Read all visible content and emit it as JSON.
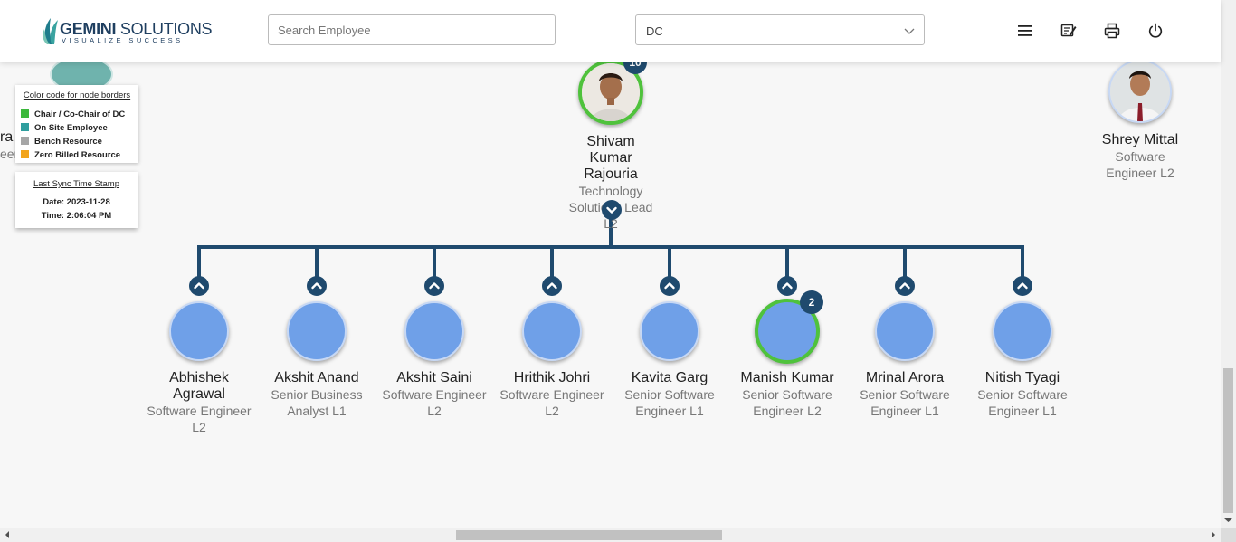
{
  "header": {
    "logo_name_bold": "GEMINI",
    "logo_name_rest": " SOLUTIONS",
    "logo_tagline": "VISUALIZE SUCCESS",
    "search_placeholder": "Search Employee",
    "dc_select_value": "DC",
    "icons": [
      "menu-icon",
      "edit-note-icon",
      "print-icon",
      "power-icon"
    ]
  },
  "legend": {
    "title": "Color code for node borders",
    "items": [
      {
        "label": "Chair / Co-Chair of DC",
        "color": "#3cb83c"
      },
      {
        "label": "On Site Employee",
        "color": "#2f9e9e"
      },
      {
        "label": "Bench Resource",
        "color": "#a6a6a6"
      },
      {
        "label": "Zero Billed Resource",
        "color": "#f2a41c"
      }
    ]
  },
  "sync": {
    "title": "Last Sync Time Stamp",
    "date": "Date: 2023-11-28",
    "time": "Time: 2:06:04 PM"
  },
  "partial_left": {
    "name_fragment": "ra",
    "desc_fragment": "eer"
  },
  "lead": {
    "name": "Shivam Kumar Rajouria",
    "desc": "Technology Solutions Lead L2",
    "badge": "10"
  },
  "peer": {
    "name": "Shrey Mittal",
    "desc": "Software Engineer L2"
  },
  "reports": [
    {
      "name": "Abhishek Agrawal",
      "desc": "Software Engineer L2",
      "badge": ""
    },
    {
      "name": "Akshit Anand",
      "desc": "Senior Business Analyst L1",
      "badge": ""
    },
    {
      "name": "Akshit Saini",
      "desc": "Software Engineer L2",
      "badge": ""
    },
    {
      "name": "Hrithik Johri",
      "desc": "Software Engineer L2",
      "badge": ""
    },
    {
      "name": "Kavita Garg",
      "desc": "Senior Software Engineer L1",
      "badge": ""
    },
    {
      "name": "Manish Kumar",
      "desc": "Senior Software Engineer L2",
      "badge": "2"
    },
    {
      "name": "Mrinal Arora",
      "desc": "Senior Software Engineer L1",
      "badge": ""
    },
    {
      "name": "Nitish Tyagi",
      "desc": "Senior Software Engineer L1",
      "badge": ""
    }
  ],
  "colors": {
    "connector": "#1f4a6e",
    "chair_border": "#4fc23c",
    "node_fill": "#6fa0e8"
  }
}
